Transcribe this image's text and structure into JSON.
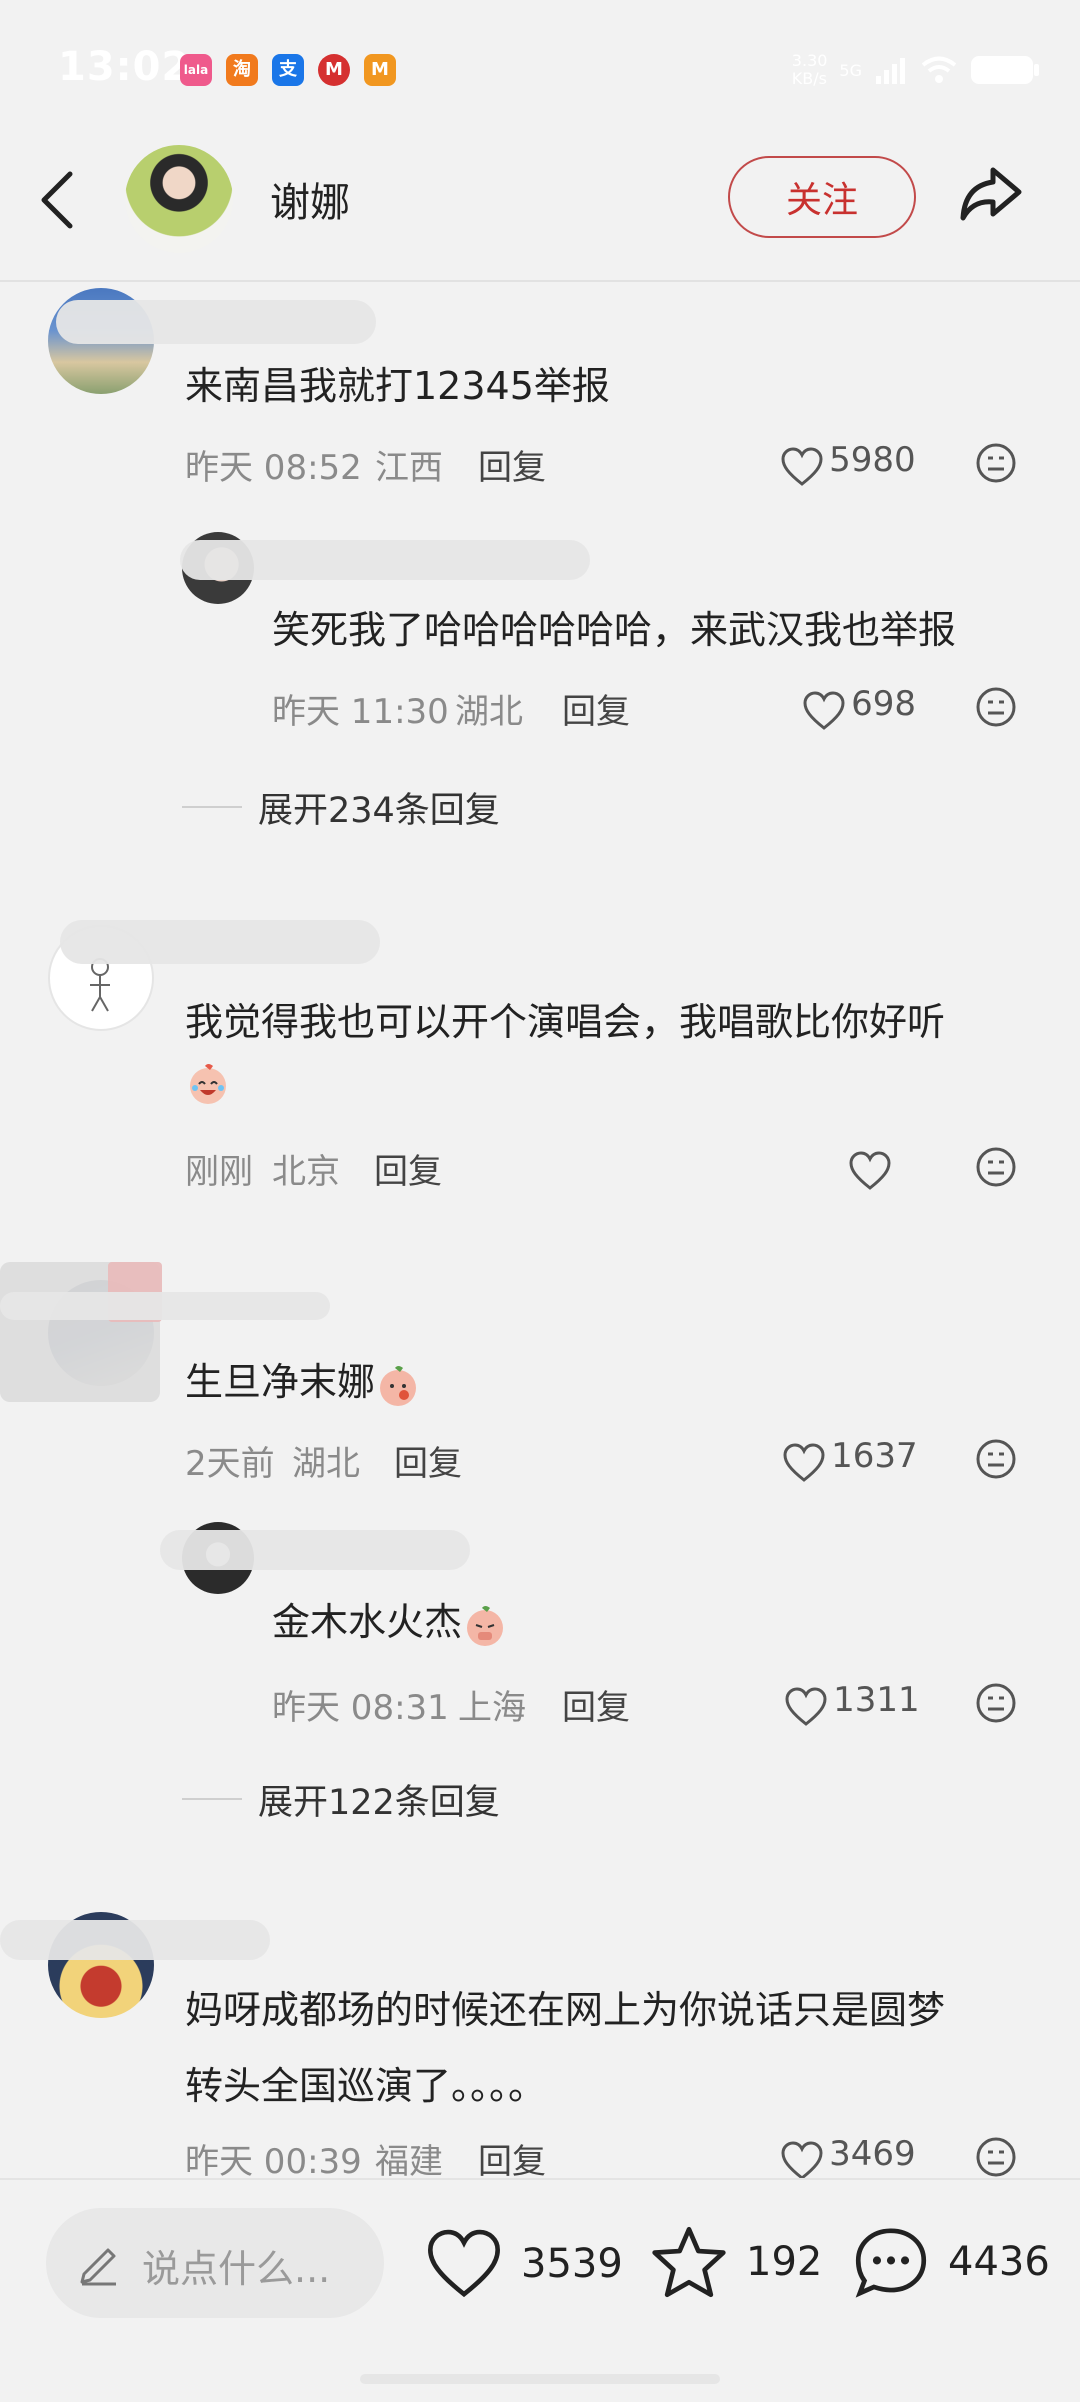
{
  "status_bar": {
    "time": "13:02",
    "net_speed": "3.30\nKB/s",
    "network": "5G",
    "apps": [
      "lala",
      "淘",
      "支",
      "M",
      "M"
    ]
  },
  "header": {
    "title": "谢娜",
    "follow_label": "关注"
  },
  "comments": [
    {
      "text": "来南昌我就打12345举报",
      "time": "昨天 08:52",
      "location": "江西",
      "reply_label": "回复",
      "likes": "5980",
      "replies": [
        {
          "text": "笑死我了哈哈哈哈哈哈，来武汉我也举报",
          "time": "昨天 11:30",
          "location": "湖北",
          "reply_label": "回复",
          "likes": "698"
        }
      ],
      "expand_label": "展开234条回复"
    },
    {
      "text": "我觉得我也可以开个演唱会，我唱歌比你好听",
      "time": "刚刚",
      "location": "北京",
      "reply_label": "回复",
      "likes": ""
    },
    {
      "text": "生旦净末娜",
      "time": "2天前",
      "location": "湖北",
      "reply_label": "回复",
      "likes": "1637",
      "replies": [
        {
          "text": "金木水火杰",
          "time": "昨天 08:31",
          "location": "上海",
          "reply_label": "回复",
          "likes": "1311"
        }
      ],
      "expand_label": "展开122条回复"
    },
    {
      "text_line1": "妈呀成都场的时候还在网上为你说话只是圆梦",
      "text_line2": "转头全国巡演了。。。。",
      "time": "昨天 00:39",
      "location": "福建",
      "reply_label": "回复",
      "likes": "3469"
    }
  ],
  "bottom_bar": {
    "input_placeholder": "说点什么...",
    "like_count": "3539",
    "star_count": "192",
    "comment_count": "4436"
  },
  "colors": {
    "background": "#f2f2f2",
    "follow_red": "#c8312f",
    "meta_gray": "#8a8a8a"
  }
}
